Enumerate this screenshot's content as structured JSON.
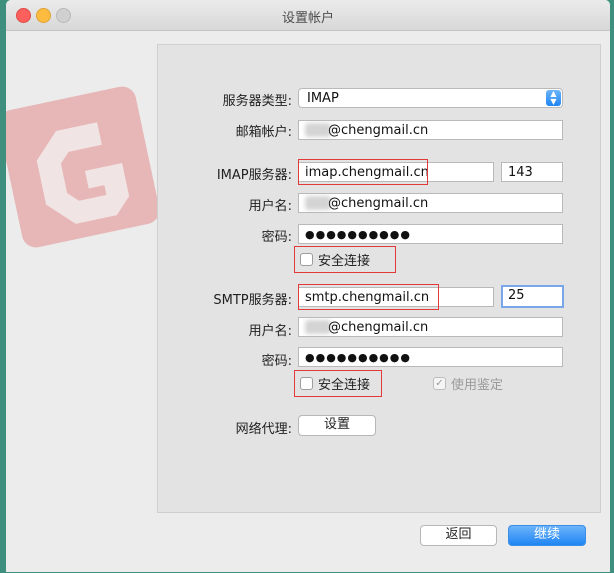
{
  "window": {
    "title": "设置帐户"
  },
  "server_type": {
    "label": "服务器类型:",
    "value": "IMAP"
  },
  "email": {
    "label": "邮箱帐户:",
    "value": "@chengmail.cn"
  },
  "imap": {
    "label": "IMAP服务器:",
    "host": "imap.chengmail.cn",
    "port": "143",
    "user_label": "用户名:",
    "user_value": "@chengmail.cn",
    "password_label": "密码:",
    "password_value": "●●●●●●●●●●",
    "secure_label": "安全连接"
  },
  "smtp": {
    "label": "SMTP服务器:",
    "host": "smtp.chengmail.cn",
    "port": "25",
    "user_label": "用户名:",
    "user_value": "@chengmail.cn",
    "password_label": "密码:",
    "password_value": "●●●●●●●●●●",
    "secure_label": "安全连接",
    "auth_label": "使用鉴定"
  },
  "proxy": {
    "label": "网络代理:",
    "button": "设置"
  },
  "footer": {
    "back": "返回",
    "continue": "继续"
  },
  "colors": {
    "accent": "#1f85f4",
    "highlight_box": "#e23a3a"
  }
}
